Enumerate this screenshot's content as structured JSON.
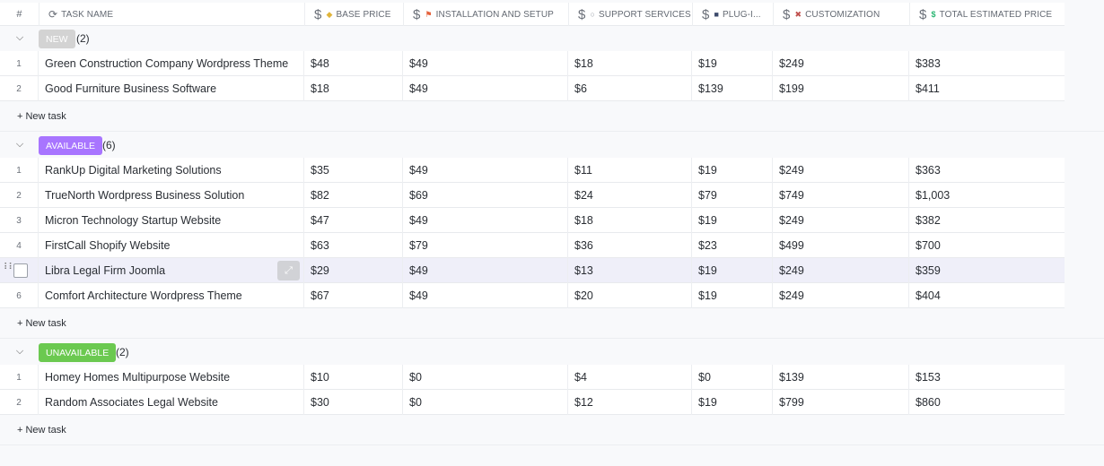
{
  "columns": {
    "num": "#",
    "task": "TASK NAME",
    "base": "BASE PRICE",
    "install": "INSTALLATION AND SETUP",
    "support": "SUPPORT SERVICES",
    "plugin": "PLUG-I...",
    "custom": "CUSTOMIZATION",
    "total": "TOTAL ESTIMATED PRICE",
    "currency_symbol": "$"
  },
  "new_task_label": "+ New task",
  "groups": [
    {
      "label": "NEW",
      "count": "(2)",
      "color": "#d3d3d3",
      "rows": [
        {
          "n": "1",
          "task": "Green Construction Company Wordpress Theme",
          "base": "$48",
          "install": "$49",
          "support": "$18",
          "plugin": "$19",
          "custom": "$249",
          "total": "$383"
        },
        {
          "n": "2",
          "task": "Good Furniture Business Software",
          "base": "$18",
          "install": "$49",
          "support": "$6",
          "plugin": "$139",
          "custom": "$199",
          "total": "$411"
        }
      ]
    },
    {
      "label": "AVAILABLE",
      "count": "(6)",
      "color": "#a875ff",
      "rows": [
        {
          "n": "1",
          "task": "RankUp Digital Marketing Solutions",
          "base": "$35",
          "install": "$49",
          "support": "$11",
          "plugin": "$19",
          "custom": "$249",
          "total": "$363"
        },
        {
          "n": "2",
          "task": "TrueNorth Wordpress Business Solution",
          "base": "$82",
          "install": "$69",
          "support": "$24",
          "plugin": "$79",
          "custom": "$749",
          "total": "$1,003"
        },
        {
          "n": "3",
          "task": "Micron Technology Startup Website",
          "base": "$47",
          "install": "$49",
          "support": "$18",
          "plugin": "$19",
          "custom": "$249",
          "total": "$382"
        },
        {
          "n": "4",
          "task": "FirstCall Shopify Website",
          "base": "$63",
          "install": "$79",
          "support": "$36",
          "plugin": "$23",
          "custom": "$499",
          "total": "$700"
        },
        {
          "n": "",
          "task": "Libra Legal Firm Joomla",
          "base": "$29",
          "install": "$49",
          "support": "$13",
          "plugin": "$19",
          "custom": "$249",
          "total": "$359",
          "hovered": true
        },
        {
          "n": "6",
          "task": "Comfort Architecture Wordpress Theme",
          "base": "$67",
          "install": "$49",
          "support": "$20",
          "plugin": "$19",
          "custom": "$249",
          "total": "$404"
        }
      ]
    },
    {
      "label": "UNAVAILABLE",
      "count": "(2)",
      "color": "#6bc950",
      "rows": [
        {
          "n": "1",
          "task": "Homey Homes Multipurpose Website",
          "base": "$10",
          "install": "$0",
          "support": "$4",
          "plugin": "$0",
          "custom": "$139",
          "total": "$153"
        },
        {
          "n": "2",
          "task": "Random Associates Legal Website",
          "base": "$30",
          "install": "$0",
          "support": "$12",
          "plugin": "$19",
          "custom": "$799",
          "total": "$860"
        }
      ]
    }
  ]
}
